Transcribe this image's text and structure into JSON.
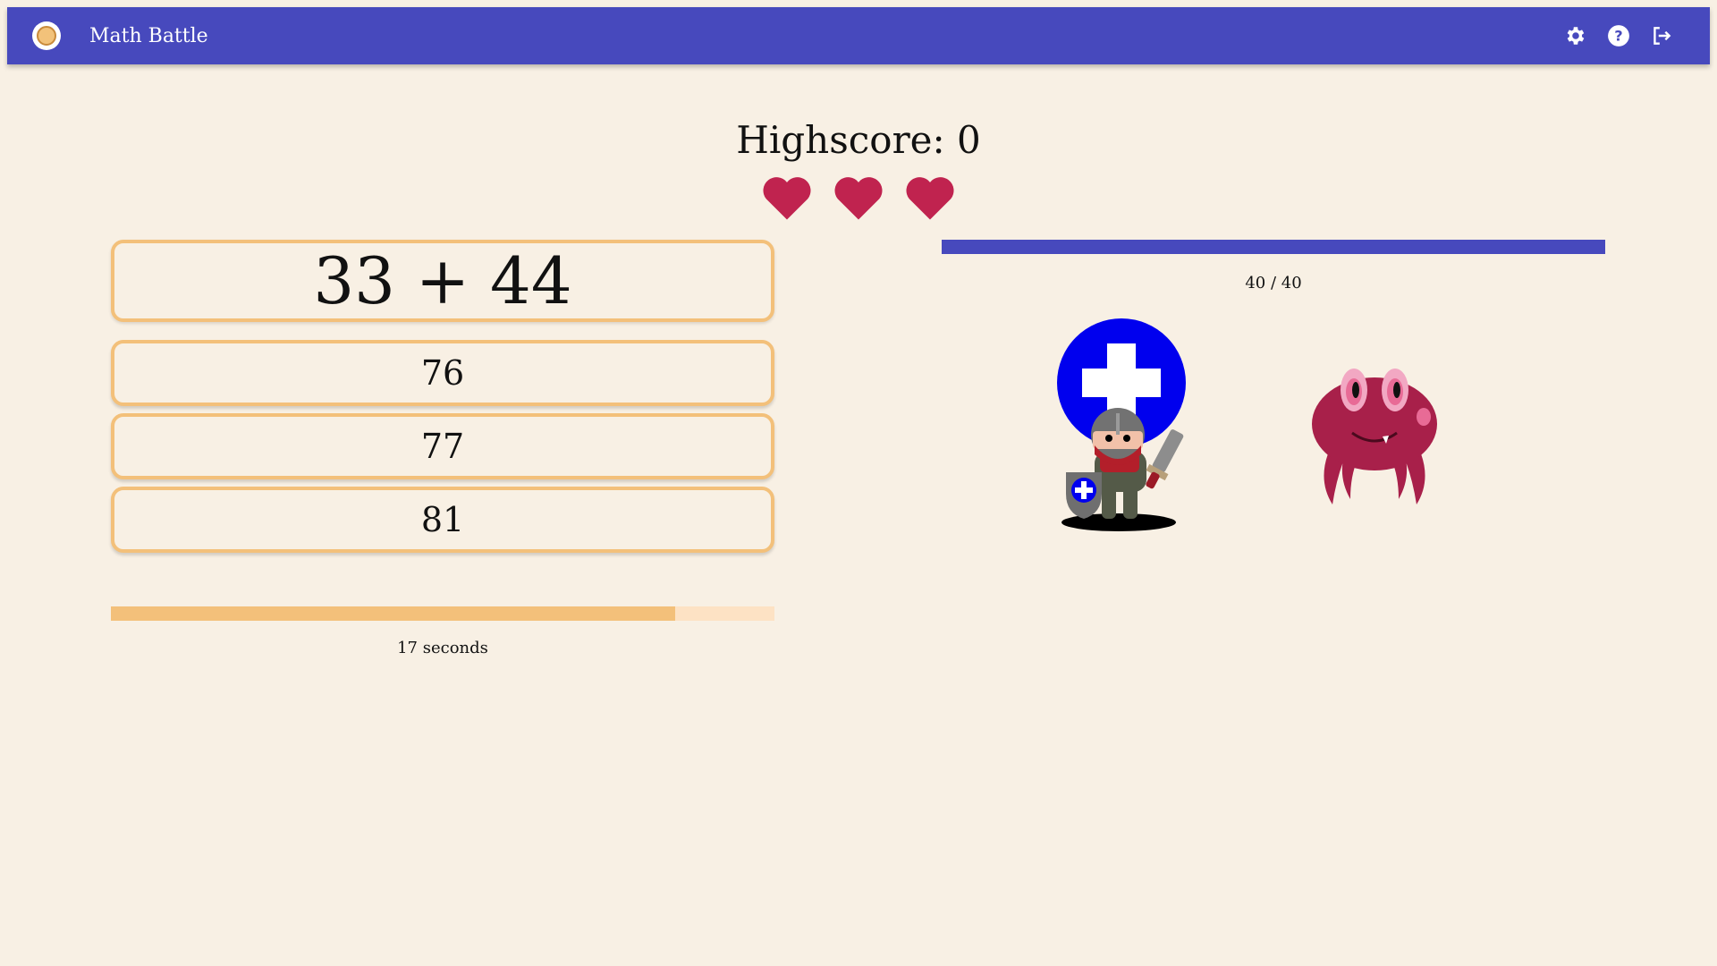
{
  "appbar": {
    "title": "Math Battle",
    "color": "#4749bd",
    "actions": [
      "gear-icon",
      "help-icon",
      "logout-icon"
    ]
  },
  "game": {
    "highscore_text": "Highscore: 0",
    "lives": 3,
    "heart_color": "#c0234f",
    "question": "33 + 44",
    "answers": [
      "76",
      "77",
      "81"
    ],
    "timer": {
      "label": "17 seconds",
      "fraction": 0.85,
      "color": "#f3c07a"
    },
    "enemy_hp": {
      "label": "40 / 40",
      "fraction": 1.0,
      "color": "#4749bd"
    },
    "hero_icon": "knight-with-heal-icon",
    "enemy_icon": "crab-monster-icon"
  }
}
